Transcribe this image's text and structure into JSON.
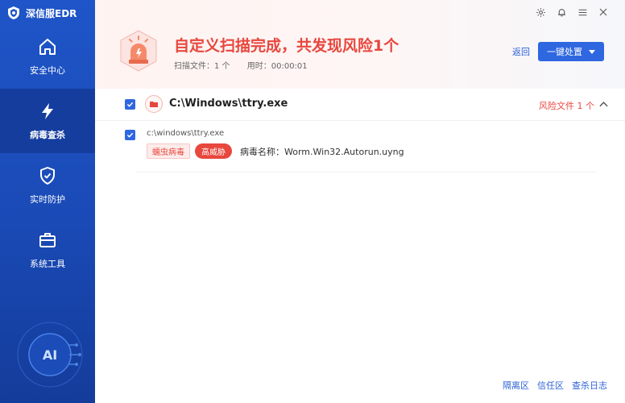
{
  "app": {
    "title": "深信服EDR"
  },
  "sidebar": {
    "items": [
      {
        "label": "安全中心",
        "icon": "home-icon"
      },
      {
        "label": "病毒查杀",
        "icon": "lightning-icon",
        "active": true
      },
      {
        "label": "实时防护",
        "icon": "shield-check-icon"
      },
      {
        "label": "系统工具",
        "icon": "toolbox-icon"
      }
    ],
    "ai_label": "AI"
  },
  "window": {
    "controls": [
      "settings-icon",
      "bell-icon",
      "menu-icon",
      "close-icon"
    ]
  },
  "scan": {
    "title": "自定义扫描完成，共发现风险1个",
    "files_label": "扫描文件：1 个",
    "time_label": "用时：00:00:01",
    "back": "返回",
    "action": "一键处置"
  },
  "results": {
    "group": {
      "path": "C:\\Windows\\ttry.exe",
      "risk_summary": "风险文件 1 个"
    },
    "items": [
      {
        "path": "c:\\windows\\ttry.exe",
        "virus_type": "蠕虫病毒",
        "level": "高威胁",
        "virus_name": "病毒名称：Worm.Win32.Autorun.uyng"
      }
    ]
  },
  "footer": {
    "links": [
      "隔离区",
      "信任区",
      "查杀日志"
    ]
  },
  "colors": {
    "accent": "#2f67e0",
    "danger": "#e8473e",
    "sidebar": "#1f55c8"
  }
}
